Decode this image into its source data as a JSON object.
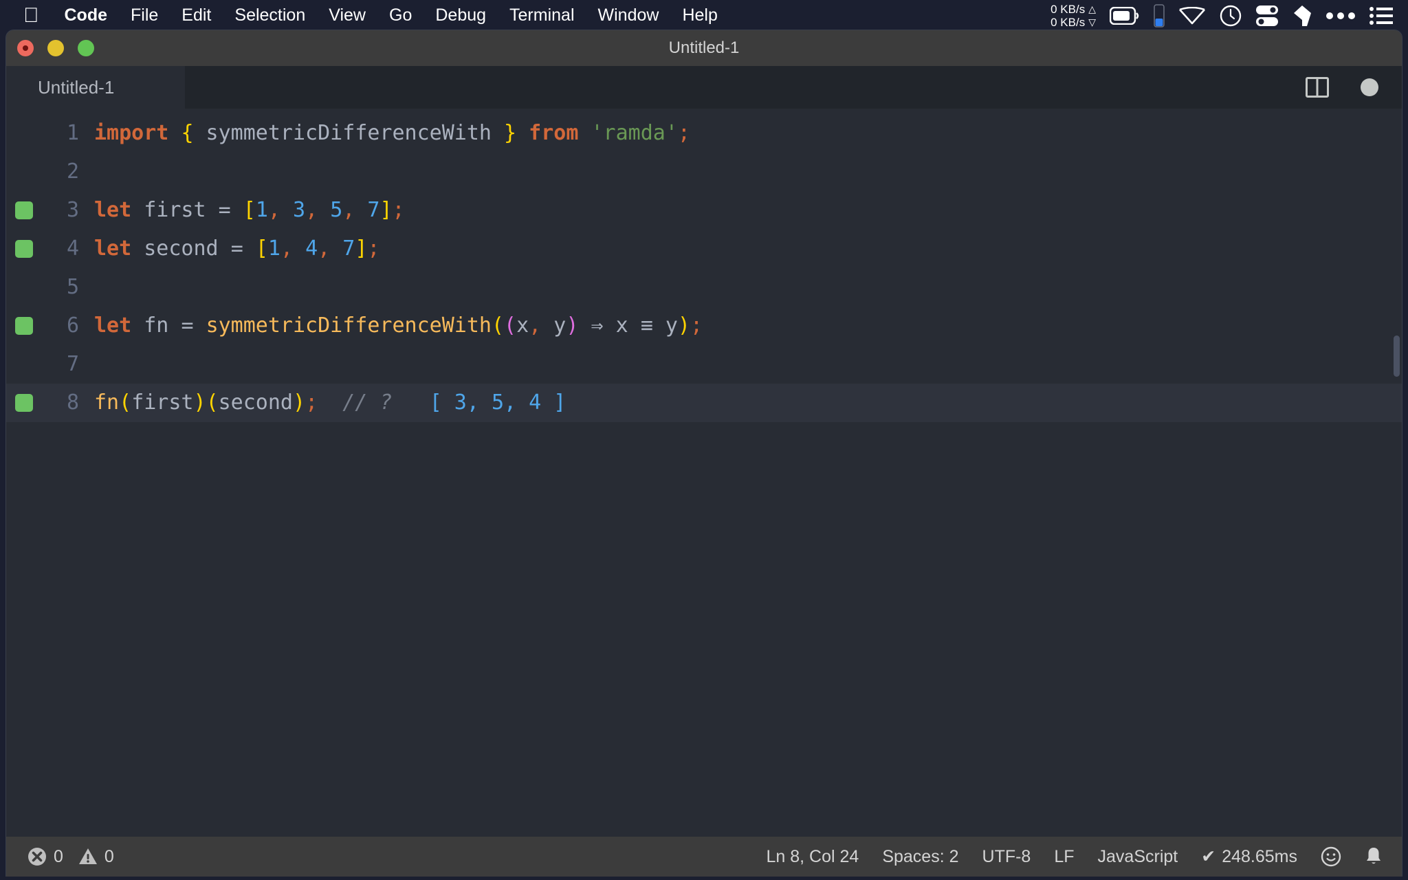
{
  "menubar": {
    "apple_icon": "apple-logo-icon",
    "items": [
      {
        "label": "Code",
        "bold": true
      },
      {
        "label": "File",
        "bold": false
      },
      {
        "label": "Edit",
        "bold": false
      },
      {
        "label": "Selection",
        "bold": false
      },
      {
        "label": "View",
        "bold": false
      },
      {
        "label": "Go",
        "bold": false
      },
      {
        "label": "Debug",
        "bold": false
      },
      {
        "label": "Terminal",
        "bold": false
      },
      {
        "label": "Window",
        "bold": false
      },
      {
        "label": "Help",
        "bold": false
      }
    ],
    "network": {
      "upload": "0 KB/s",
      "download": "0 KB/s",
      "up_arrow": "△",
      "down_arrow": "▽"
    },
    "tray_icons": [
      "battery-icon",
      "memory-bar-icon",
      "wifi-icon",
      "clock-icon",
      "toggles-icon",
      "eraser-icon",
      "ellipsis-icon",
      "list-menu-icon"
    ]
  },
  "window": {
    "title": "Untitled-1",
    "traffic_lights": [
      "close-button",
      "minimize-button",
      "maximize-button"
    ],
    "close_has_unsaved_dot": true
  },
  "tabbar": {
    "tabs": [
      {
        "label": "Untitled-1",
        "active": true
      }
    ],
    "actions": [
      "split-editor-icon",
      "unsaved-dot-icon"
    ]
  },
  "editor": {
    "lines": [
      {
        "number": "1",
        "marked": false,
        "active": false,
        "tokens": [
          {
            "t": "import",
            "c": "kw"
          },
          {
            "t": " ",
            "c": "id"
          },
          {
            "t": "{",
            "c": "br1"
          },
          {
            "t": " symmetricDifferenceWith ",
            "c": "id"
          },
          {
            "t": "}",
            "c": "br1"
          },
          {
            "t": " ",
            "c": "id"
          },
          {
            "t": "from",
            "c": "kw"
          },
          {
            "t": " ",
            "c": "id"
          },
          {
            "t": "'ramda'",
            "c": "str"
          },
          {
            "t": ";",
            "c": "pun-or"
          }
        ]
      },
      {
        "number": "2",
        "marked": false,
        "active": false,
        "tokens": []
      },
      {
        "number": "3",
        "marked": true,
        "active": false,
        "tokens": [
          {
            "t": "let",
            "c": "kw"
          },
          {
            "t": " first ",
            "c": "id"
          },
          {
            "t": "=",
            "c": "id"
          },
          {
            "t": " ",
            "c": "id"
          },
          {
            "t": "[",
            "c": "br1"
          },
          {
            "t": "1",
            "c": "num"
          },
          {
            "t": ",",
            "c": "pun-or"
          },
          {
            "t": " ",
            "c": "id"
          },
          {
            "t": "3",
            "c": "num"
          },
          {
            "t": ",",
            "c": "pun-or"
          },
          {
            "t": " ",
            "c": "id"
          },
          {
            "t": "5",
            "c": "num"
          },
          {
            "t": ",",
            "c": "pun-or"
          },
          {
            "t": " ",
            "c": "id"
          },
          {
            "t": "7",
            "c": "num"
          },
          {
            "t": "]",
            "c": "br1"
          },
          {
            "t": ";",
            "c": "pun-or"
          }
        ]
      },
      {
        "number": "4",
        "marked": true,
        "active": false,
        "tokens": [
          {
            "t": "let",
            "c": "kw"
          },
          {
            "t": " second ",
            "c": "id"
          },
          {
            "t": "=",
            "c": "id"
          },
          {
            "t": " ",
            "c": "id"
          },
          {
            "t": "[",
            "c": "br1"
          },
          {
            "t": "1",
            "c": "num"
          },
          {
            "t": ",",
            "c": "pun-or"
          },
          {
            "t": " ",
            "c": "id"
          },
          {
            "t": "4",
            "c": "num"
          },
          {
            "t": ",",
            "c": "pun-or"
          },
          {
            "t": " ",
            "c": "id"
          },
          {
            "t": "7",
            "c": "num"
          },
          {
            "t": "]",
            "c": "br1"
          },
          {
            "t": ";",
            "c": "pun-or"
          }
        ]
      },
      {
        "number": "5",
        "marked": false,
        "active": false,
        "tokens": []
      },
      {
        "number": "6",
        "marked": true,
        "active": false,
        "tokens": [
          {
            "t": "let",
            "c": "kw"
          },
          {
            "t": " fn ",
            "c": "id"
          },
          {
            "t": "=",
            "c": "id"
          },
          {
            "t": " ",
            "c": "id"
          },
          {
            "t": "symmetricDifferenceWith",
            "c": "fn"
          },
          {
            "t": "(",
            "c": "br1"
          },
          {
            "t": "(",
            "c": "br2"
          },
          {
            "t": "x",
            "c": "id"
          },
          {
            "t": ",",
            "c": "pun-or"
          },
          {
            "t": " y",
            "c": "id"
          },
          {
            "t": ")",
            "c": "br2"
          },
          {
            "t": " ⇒ x ≡ y",
            "c": "id"
          },
          {
            "t": ")",
            "c": "br1"
          },
          {
            "t": ";",
            "c": "pun-or"
          }
        ]
      },
      {
        "number": "7",
        "marked": false,
        "active": false,
        "tokens": []
      },
      {
        "number": "8",
        "marked": true,
        "active": true,
        "tokens": [
          {
            "t": "fn",
            "c": "fn"
          },
          {
            "t": "(",
            "c": "br1"
          },
          {
            "t": "first",
            "c": "id"
          },
          {
            "t": ")",
            "c": "br1"
          },
          {
            "t": "(",
            "c": "br1"
          },
          {
            "t": "second",
            "c": "id"
          },
          {
            "t": ")",
            "c": "br1"
          },
          {
            "t": ";",
            "c": "pun-or"
          },
          {
            "t": "  ",
            "c": "id"
          },
          {
            "t": "// ?",
            "c": "com"
          },
          {
            "t": "   ",
            "c": "id"
          },
          {
            "t": "[ 3, 5, 4 ]",
            "c": "res"
          }
        ]
      }
    ],
    "raw_source": "import { symmetricDifferenceWith } from 'ramda';\n\nlet first = [1, 3, 5, 7];\nlet second = [1, 4, 7];\n\nlet fn = symmetricDifferenceWith((x, y) => x === y);\n\nfn(first)(second);  // ?   [ 3, 5, 4 ]"
  },
  "statusbar": {
    "errors": "0",
    "warnings": "0",
    "cursor": "Ln 8, Col 24",
    "indent": "Spaces: 2",
    "encoding": "UTF-8",
    "eol": "LF",
    "language": "JavaScript",
    "run_time": "248.65ms",
    "run_check": "✔",
    "feedback_icon": "smiley-icon",
    "bell_icon": "bell-icon"
  },
  "colors": {
    "menubar_bg": "#1b1f30",
    "titlebar_bg": "#3c3c3c",
    "editor_bg": "#282c34",
    "tabbar_bg": "#21252b",
    "active_line_bg": "#2f333d",
    "keyword": "#d2683a",
    "function": "#f7ba5b",
    "string": "#6a9955",
    "number": "#4fa6ea",
    "bracket1": "#ffd400",
    "bracket2": "#e06ee0",
    "comment": "#777e8b",
    "gutter_mark": "#6cc363",
    "text": "#abb2bf"
  }
}
